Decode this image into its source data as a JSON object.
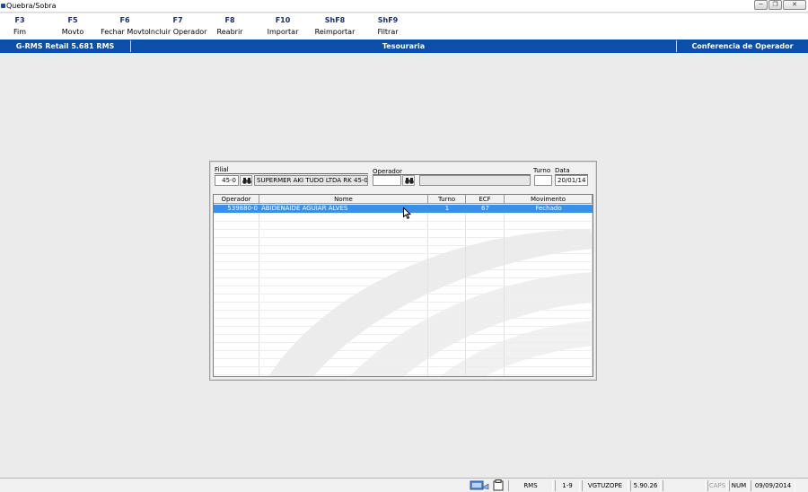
{
  "window": {
    "title": "Quebra/Sobra"
  },
  "toolbar": {
    "items": [
      {
        "key": "F3",
        "label": "Fim"
      },
      {
        "key": "F5",
        "label": "Movto"
      },
      {
        "key": "F6",
        "label": "Fechar Movto"
      },
      {
        "key": "F7",
        "label": "Incluir Operador"
      },
      {
        "key": "F8",
        "label": "Reabrir"
      },
      {
        "key": "F10",
        "label": "Importar"
      },
      {
        "key": "ShF8",
        "label": "Reimportar"
      },
      {
        "key": "ShF9",
        "label": "Filtrar"
      }
    ]
  },
  "module_bar": {
    "app": "G-RMS Retail 5.681 RMS",
    "module": "Tesouraria",
    "screen": "Conferencia de Operador"
  },
  "form": {
    "filial_label": "Filial",
    "filial_value": "45-0",
    "store_name": "SUPERMER AKI TUDO LTDA RK 45-0",
    "operador_label": "Operador",
    "operador_value": "",
    "operador_name": "",
    "turno_label": "Turno",
    "turno_value": "",
    "data_label": "Data",
    "data_value": "20/01/14"
  },
  "grid": {
    "columns": [
      "Operador",
      "Nome",
      "Turno",
      "ECF",
      "Movimento"
    ],
    "rows": [
      {
        "operador": "539880-0",
        "nome": "ABIDENAIDE AGUIAR ALVES",
        "turno": "1",
        "ecf": "67",
        "movimento": "Fechado"
      }
    ]
  },
  "statusbar": {
    "system": "RMS",
    "range": "1-9",
    "user": "VGTUZOPE",
    "version": "5.90.26",
    "caps": "CAPS",
    "num": "NUM",
    "date": "09/09/2014"
  },
  "colors": {
    "module_bar": "#0b4fa8",
    "selection": "#3d8ee6",
    "toolbar_key": "#1b2d6e"
  }
}
